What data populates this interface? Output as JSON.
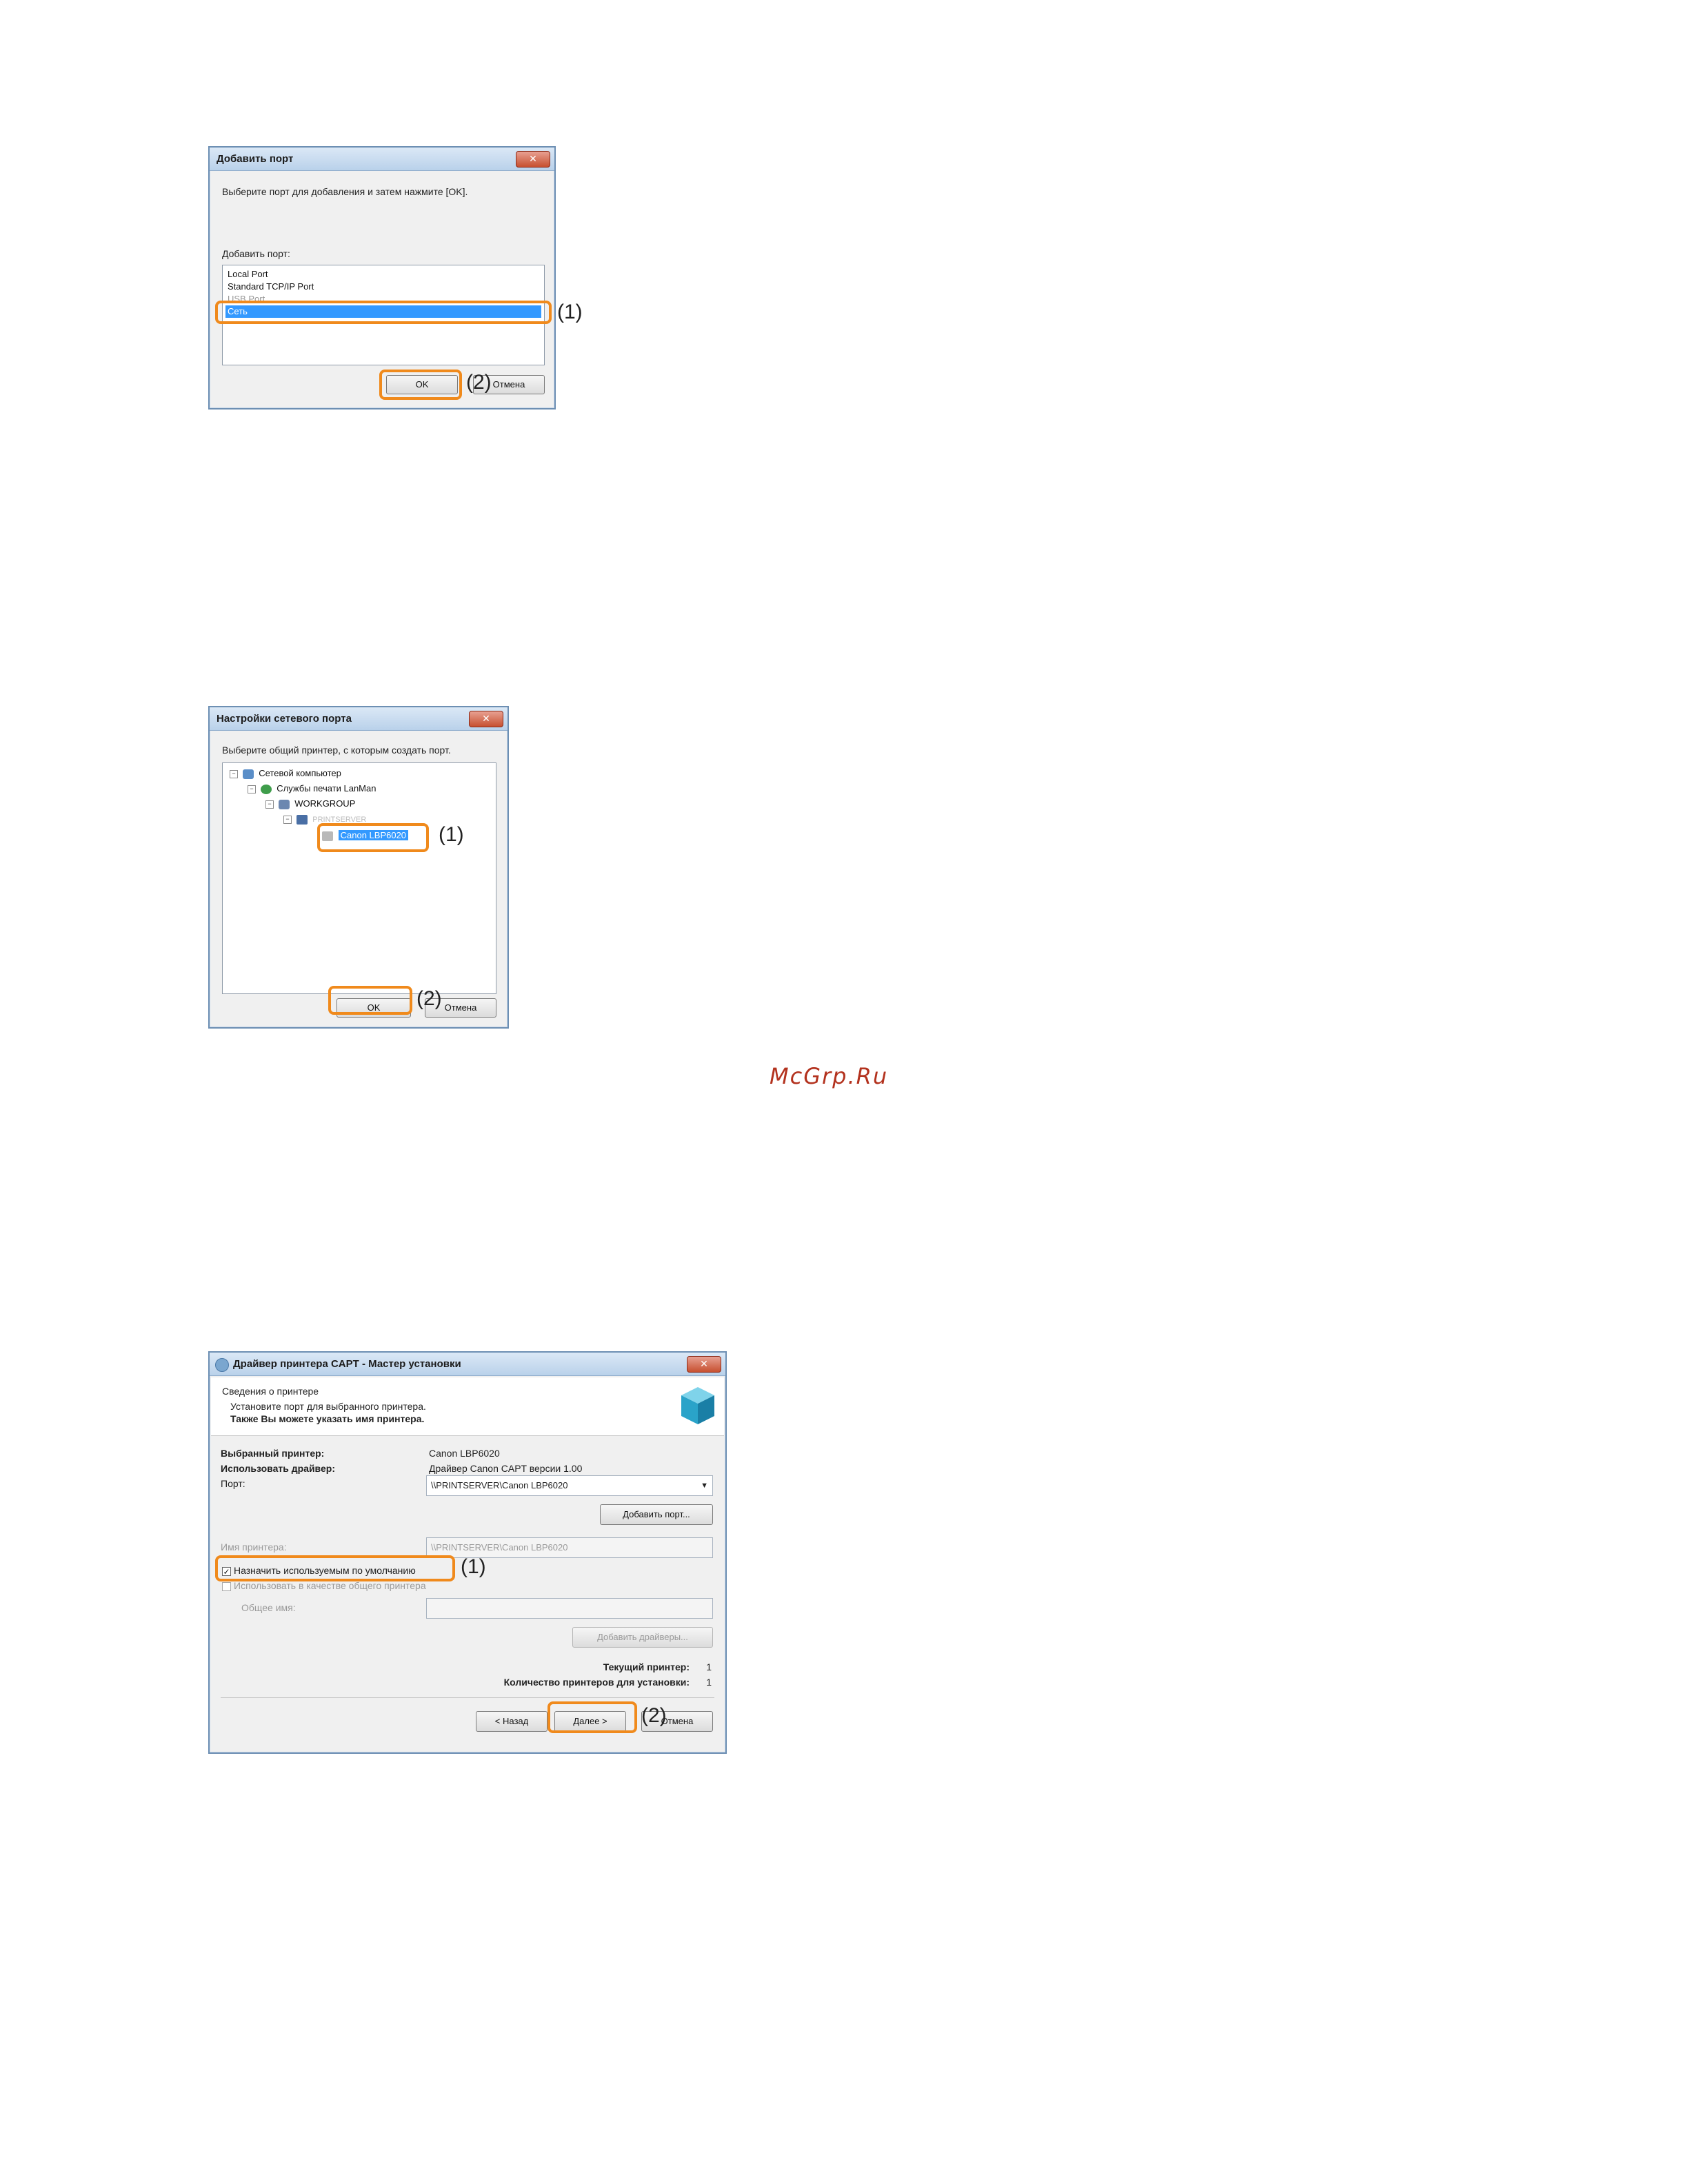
{
  "dialog1": {
    "title": "Добавить порт",
    "close_glyph": "✕",
    "instruction": "Выберите порт для добавления и затем нажмите [OK].",
    "list_label": "Добавить порт:",
    "ports": [
      "Local Port",
      "Standard TCP/IP Port",
      "USB Port",
      "Сеть"
    ],
    "selected_port": "Сеть",
    "ok_label": "OK",
    "cancel_label": "Отмена",
    "callout_1": "(1)",
    "callout_2": "(2)"
  },
  "dialog2": {
    "title": "Настройки сетевого порта",
    "close_glyph": "✕",
    "instruction": "Выберите общий принтер, с которым создать порт.",
    "tree": {
      "node1": "Сетевой компьютер",
      "node2": "Службы печати LanMan",
      "node3": "WORKGROUP",
      "node4": "PRINTSERVER",
      "node5": "Canon LBP6020"
    },
    "ok_label": "OK",
    "cancel_label": "Отмена",
    "callout_1": "(1)",
    "callout_2": "(2)"
  },
  "dialog3": {
    "title": "Драйвер принтера CAPT - Мастер установки",
    "close_glyph": "✕",
    "header_title": "Сведения о принтере",
    "header_line1": "Установите порт для выбранного принтера.",
    "header_line2": "Также Вы можете указать имя принтера.",
    "selected_printer_label": "Выбранный принтер:",
    "selected_printer_value": "Canon LBP6020",
    "driver_label": "Использовать драйвер:",
    "driver_value": "Драйвер Canon CAPT версии 1.00",
    "port_label": "Порт:",
    "port_value": "\\\\PRINTSERVER\\Canon LBP6020",
    "add_port_button": "Добавить порт...",
    "printer_name_label": "Имя принтера:",
    "printer_name_value": "\\\\PRINTSERVER\\Canon LBP6020",
    "set_default_label": "Назначить используемым по умолчанию",
    "set_default_checked": true,
    "share_label": "Использовать в качестве общего принтера",
    "share_name_label": "Общее имя:",
    "add_drivers_button": "Добавить драйверы...",
    "current_printer_label": "Текущий принтер:",
    "current_printer_value": "1",
    "count_label": "Количество принтеров для установки:",
    "count_value": "1",
    "back_button": "< Назад",
    "next_button": "Далее >",
    "cancel_button": "Отмена",
    "callout_1": "(1)",
    "callout_2": "(2)"
  },
  "watermark": "McGrp.Ru",
  "colors": {
    "highlight": "#f08a1c",
    "selection": "#3399ff",
    "watermark": "#b3321e"
  }
}
